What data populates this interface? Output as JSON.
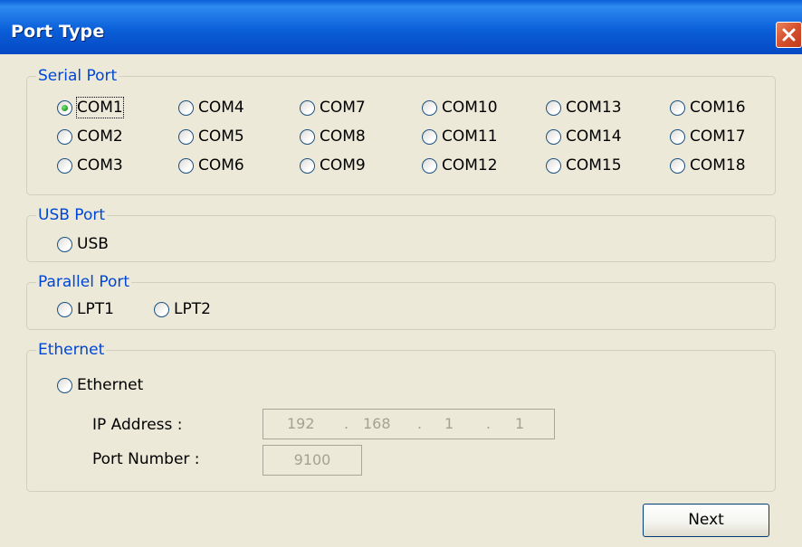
{
  "window": {
    "title": "Port Type",
    "close_icon": "close-icon"
  },
  "serial": {
    "legend": "Serial Port",
    "ports": [
      "COM1",
      "COM2",
      "COM3",
      "COM4",
      "COM5",
      "COM6",
      "COM7",
      "COM8",
      "COM9",
      "COM10",
      "COM11",
      "COM12",
      "COM13",
      "COM14",
      "COM15",
      "COM16",
      "COM17",
      "COM18"
    ],
    "selected": "COM1"
  },
  "usb": {
    "legend": "USB Port",
    "option": "USB"
  },
  "parallel": {
    "legend": "Parallel Port",
    "options": [
      "LPT1",
      "LPT2"
    ]
  },
  "ethernet": {
    "legend": "Ethernet",
    "option": "Ethernet",
    "ip_label": "IP Address :",
    "ip_parts": [
      "192",
      "168",
      "1",
      "1"
    ],
    "ip_separator": ".",
    "port_label": "Port Number :",
    "port_value": "9100"
  },
  "buttons": {
    "next": "Next"
  },
  "colors": {
    "title_bar": "#0a5fd8",
    "legend_text": "#0046d5",
    "dialog_bg": "#ece9d8",
    "close_button": "#d5502c",
    "selected_dot": "#2fa82c"
  }
}
